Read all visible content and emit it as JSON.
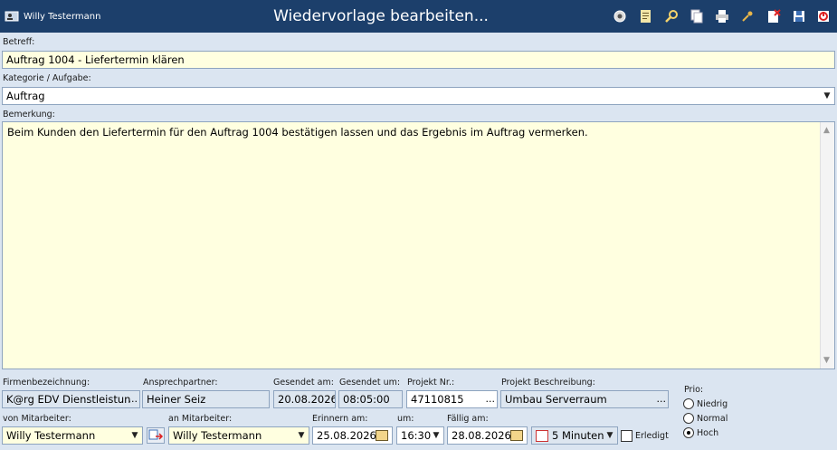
{
  "header": {
    "user_name": "Willy Testermann",
    "title": "Wiedervorlage bearbeiten...",
    "toolbar_icons": [
      "settings-icon",
      "notes-icon",
      "search-icon",
      "copy-icon",
      "print-icon",
      "pin-icon",
      "delete-icon",
      "save-icon",
      "exit-icon"
    ]
  },
  "betreff": {
    "label": "Betreff:",
    "value": "Auftrag 1004 - Liefertermin klären"
  },
  "kategorie": {
    "label": "Kategorie / Aufgabe:",
    "value": "Auftrag"
  },
  "bemerkung": {
    "label": "Bemerkung:",
    "value": "Beim Kunden den Liefertermin für den Auftrag 1004 bestätigen lassen und das Ergebnis im Auftrag vermerken."
  },
  "firma": {
    "label": "Firmenbezeichnung:",
    "value": "K@rg EDV Dienstleistun",
    "button": "..."
  },
  "ansprechpartner": {
    "label": "Ansprechpartner:",
    "value": "Heiner Seiz"
  },
  "gesendet_am": {
    "label": "Gesendet am:",
    "value": "20.08.2026"
  },
  "gesendet_um": {
    "label": "Gesendet um:",
    "value": "08:05:00"
  },
  "projekt_nr": {
    "label": "Projekt Nr.:",
    "value": "47110815",
    "button": "..."
  },
  "projekt_beschreibung": {
    "label": "Projekt Beschreibung:",
    "value": "Umbau Serverraum",
    "button": "..."
  },
  "von_mitarbeiter": {
    "label": "von Mitarbeiter:",
    "value": "Willy Testermann"
  },
  "an_mitarbeiter": {
    "label": "an Mitarbeiter:",
    "value": "Willy Testermann"
  },
  "erinnern_am": {
    "label": "Erinnern am:",
    "value": "25.08.2026"
  },
  "um": {
    "label": "um:",
    "value": "16:30"
  },
  "faellig_am": {
    "label": "Fällig am:",
    "value": "28.08.2026"
  },
  "reminder": {
    "value": "5 Minuten"
  },
  "erledigt": {
    "label": "Erledigt",
    "checked": false
  },
  "prio": {
    "label": "Prio:",
    "options": [
      "Niedrig",
      "Normal",
      "Hoch"
    ],
    "selected": "Hoch"
  },
  "colors": {
    "titlebar": "#1c3f6b",
    "background": "#dbe5f1",
    "memo": "#ffffe0"
  }
}
